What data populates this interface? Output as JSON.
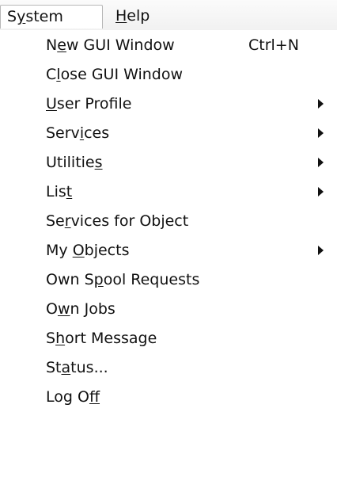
{
  "menubar": {
    "items": [
      {
        "pre": "S",
        "u": "y",
        "post": "stem",
        "active": true
      },
      {
        "pre": "",
        "u": "H",
        "post": "elp",
        "active": false
      }
    ]
  },
  "system_menu": {
    "items": [
      {
        "pre": "N",
        "u": "e",
        "post": "w GUI Window",
        "shortcut": "Ctrl+N",
        "submenu": false
      },
      {
        "pre": "C",
        "u": "l",
        "post": "ose GUI Window",
        "shortcut": "",
        "submenu": false
      },
      {
        "pre": "",
        "u": "U",
        "post": "ser Profile",
        "shortcut": "",
        "submenu": true
      },
      {
        "pre": "Serv",
        "u": "i",
        "post": "ces",
        "shortcut": "",
        "submenu": true
      },
      {
        "pre": "Utilitie",
        "u": "s",
        "post": "",
        "shortcut": "",
        "submenu": true
      },
      {
        "pre": "Lis",
        "u": "t",
        "post": "",
        "shortcut": "",
        "submenu": true
      },
      {
        "pre": "Se",
        "u": "r",
        "post": "vices for Object",
        "shortcut": "",
        "submenu": false
      },
      {
        "pre": "My ",
        "u": "O",
        "post": "bjects",
        "shortcut": "",
        "submenu": true
      },
      {
        "pre": "Own S",
        "u": "p",
        "post": "ool Requests",
        "shortcut": "",
        "submenu": false
      },
      {
        "pre": "O",
        "u": "w",
        "post": "n Jobs",
        "shortcut": "",
        "submenu": false
      },
      {
        "pre": "S",
        "u": "h",
        "post": "ort Message",
        "shortcut": "",
        "submenu": false
      },
      {
        "pre": "St",
        "u": "a",
        "post": "tus...",
        "shortcut": "",
        "submenu": false
      },
      {
        "pre": "Log O",
        "u": "f",
        "post": "f",
        "shortcut": "",
        "submenu": false
      }
    ]
  }
}
